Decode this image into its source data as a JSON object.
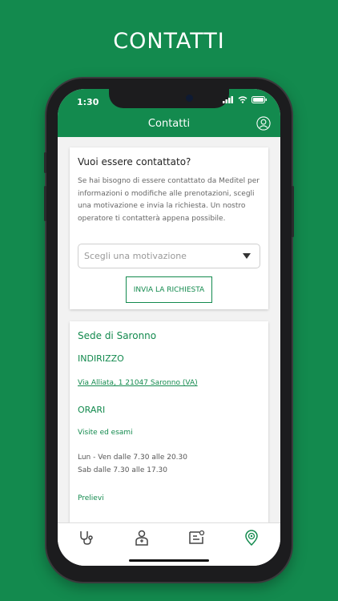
{
  "promo": {
    "title": "CONTATTI"
  },
  "status_bar": {
    "time": "1:30"
  },
  "header": {
    "title": "Contatti",
    "profile_icon": "user-circle-icon"
  },
  "contact_card": {
    "title": "Vuoi essere contattato?",
    "description": "Se hai bisogno di essere contattato da Meditel per informazioni o modifiche alle prenotazioni, scegli una motivazione e invia la richiesta. Un nostro operatore ti contatterà appena possibile.",
    "select_placeholder": "Scegli una motivazione",
    "submit_label": "INVIA LA RICHIESTA"
  },
  "location_card": {
    "title": "Sede di Saronno",
    "address_heading": "INDIRIZZO",
    "address": "Via Alliata, 1 21047 Saronno (VA)",
    "hours_heading": "ORARI",
    "visits_heading": "Visite ed esami",
    "hours_weekdays": "Lun - Ven dalle 7.30 alle 20.30",
    "hours_saturday": "Sab dalle 7.30 alle 17.30",
    "prelievi_heading": "Prelievi"
  },
  "tabbar": {
    "items": [
      {
        "icon": "stethoscope-icon",
        "active": false
      },
      {
        "icon": "doctor-icon",
        "active": false
      },
      {
        "icon": "chat-icon",
        "active": false
      },
      {
        "icon": "location-pin-icon",
        "active": true
      }
    ]
  },
  "colors": {
    "brand_green": "#138a4e",
    "background_gray": "#f2f2f2"
  }
}
